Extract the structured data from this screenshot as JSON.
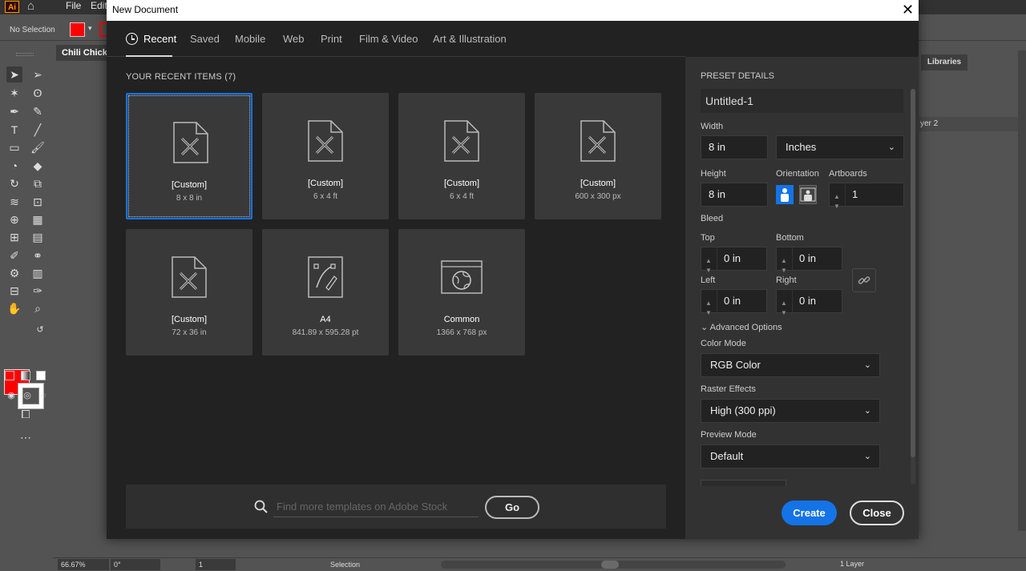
{
  "app": {
    "menu": [
      "File",
      "Edit"
    ],
    "control_bar": {
      "selection": "No Selection"
    },
    "document_tab": "Chili Chicke",
    "right_panel": {
      "tab": "Libraries",
      "layer_name": "yer 2"
    },
    "status_bar": {
      "zoom": "66.67%",
      "rotation": "0°",
      "page": "1",
      "tool": "Selection",
      "layers": "1 Layer"
    },
    "colors": {
      "fill": "#ff0000",
      "accent": "#1473e6"
    }
  },
  "dialog": {
    "title": "New Document",
    "tabs": [
      "Recent",
      "Saved",
      "Mobile",
      "Web",
      "Print",
      "Film & Video",
      "Art & Illustration"
    ],
    "active_tab": "Recent",
    "recent_header": "YOUR RECENT ITEMS",
    "recent_count": "(7)",
    "recent_items": [
      {
        "name": "[Custom]",
        "size": "8 x 8 in",
        "icon": "custom-doc-icon",
        "selected": true
      },
      {
        "name": "[Custom]",
        "size": "6 x 4 ft",
        "icon": "custom-doc-icon"
      },
      {
        "name": "[Custom]",
        "size": "6 x 4 ft",
        "icon": "custom-doc-icon"
      },
      {
        "name": "[Custom]",
        "size": "600 x 300 px",
        "icon": "custom-doc-icon"
      },
      {
        "name": "[Custom]",
        "size": "72 x 36 in",
        "icon": "custom-doc-icon"
      },
      {
        "name": "A4",
        "size": "841.89 x 595.28 pt",
        "icon": "print-doc-icon"
      },
      {
        "name": "Common",
        "size": "1366 x 768 px",
        "icon": "web-doc-icon"
      }
    ],
    "search": {
      "placeholder": "Find more templates on Adobe Stock",
      "go_label": "Go"
    },
    "preset": {
      "header": "PRESET DETAILS",
      "document_name": "Untitled-1",
      "width_label": "Width",
      "width_value": "8 in",
      "units": "Inches",
      "height_label": "Height",
      "height_value": "8 in",
      "orientation_label": "Orientation",
      "artboards_label": "Artboards",
      "artboards_value": "1",
      "bleed_label": "Bleed",
      "top_label": "Top",
      "top_value": "0 in",
      "bottom_label": "Bottom",
      "bottom_value": "0 in",
      "left_label": "Left",
      "left_value": "0 in",
      "right_label": "Right",
      "right_value": "0 in",
      "advanced_label": "Advanced Options",
      "color_mode_label": "Color Mode",
      "color_mode_value": "RGB Color",
      "raster_label": "Raster Effects",
      "raster_value": "High (300 ppi)",
      "preview_label": "Preview Mode",
      "preview_value": "Default"
    },
    "buttons": {
      "create": "Create",
      "close": "Close"
    }
  }
}
